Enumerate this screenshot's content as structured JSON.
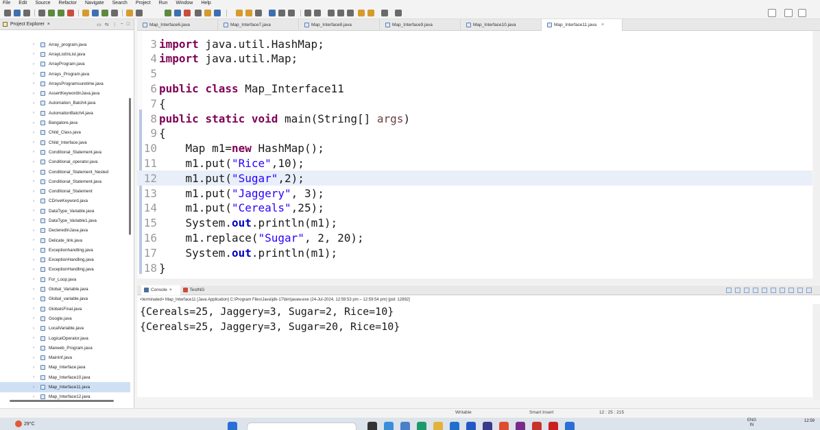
{
  "menu": [
    "File",
    "Edit",
    "Source",
    "Refactor",
    "Navigate",
    "Search",
    "Project",
    "Run",
    "Window",
    "Help"
  ],
  "explorer": {
    "title": "Project Explorer",
    "close": "×",
    "files": [
      "Array_program.java",
      "ArrayListInList.java",
      "ArrayProgram.java",
      "Arrays_Program.java",
      "ArraysProgramsuretime.java",
      "AssertKeywordInJava.java",
      "Automation_Batch4.java",
      "AutomationBatch4.java",
      "Bangalore.java",
      "Child_Class.java",
      "Child_Interface.java",
      "Conditional_Statement.java",
      "Conditional_operator.java",
      "Conditional_Statement_Nested",
      "Conditional_Statement.java",
      "Conditional_Statement",
      "CDriveKeyword.java",
      "DataType_Variable.java",
      "DataType_Variable1.java",
      "DecleredInJava.java",
      "Delicate_link.java",
      "Exceptionhandling.java",
      "ExceptionHandling.java",
      "ExceptionHandling.java",
      "For_Loop.java",
      "Global_Variable.java",
      "Global_variable.java",
      "GlobalsFinal.java",
      "Google.java",
      "LocalVariable.java",
      "LogicalOperator.java",
      "Maneeb_Program.java",
      "MainInf.java",
      "Map_Interface.java",
      "Map_Interface10.java",
      "Map_Interface11.java",
      "Map_Interface12.java"
    ],
    "selected_index": 35
  },
  "tabs": [
    {
      "label": "Map_Interface6.java",
      "active": false
    },
    {
      "label": "Map_Interface7.java",
      "active": false
    },
    {
      "label": "Map_Interface8.java",
      "active": false
    },
    {
      "label": "Map_Interface9.java",
      "active": false
    },
    {
      "label": "Map_Interface10.java",
      "active": false
    },
    {
      "label": "Map_Interface11.java",
      "active": true
    }
  ],
  "tab_close": "×",
  "editor": {
    "highlight_line": 12,
    "lines": [
      {
        "n": "3",
        "indent": "",
        "tokens": [
          {
            "t": "import",
            "c": "kw"
          },
          {
            "t": " java.util.HashMap;",
            "c": ""
          }
        ]
      },
      {
        "n": "4",
        "indent": "",
        "tokens": [
          {
            "t": "import",
            "c": "kw"
          },
          {
            "t": " java.util.Map;",
            "c": ""
          }
        ]
      },
      {
        "n": "5",
        "indent": "",
        "tokens": []
      },
      {
        "n": "6",
        "indent": "",
        "tokens": [
          {
            "t": "public",
            "c": "kw"
          },
          {
            "t": " ",
            "c": ""
          },
          {
            "t": "class",
            "c": "kw"
          },
          {
            "t": " Map_Interface11",
            "c": ""
          }
        ]
      },
      {
        "n": "7",
        "indent": "",
        "tokens": [
          {
            "t": "{",
            "c": ""
          }
        ]
      },
      {
        "n": "8",
        "indent": "",
        "tokens": [
          {
            "t": "public",
            "c": "kw"
          },
          {
            "t": " ",
            "c": ""
          },
          {
            "t": "static",
            "c": "kw"
          },
          {
            "t": " ",
            "c": ""
          },
          {
            "t": "void",
            "c": "kw"
          },
          {
            "t": " main(String[] ",
            "c": ""
          },
          {
            "t": "args",
            "c": "var"
          },
          {
            "t": ")",
            "c": ""
          }
        ]
      },
      {
        "n": "9",
        "indent": "",
        "tokens": [
          {
            "t": "{",
            "c": ""
          }
        ]
      },
      {
        "n": "10",
        "indent": "    ",
        "tokens": [
          {
            "t": "Map m1=",
            "c": ""
          },
          {
            "t": "new",
            "c": "kw"
          },
          {
            "t": " HashMap();",
            "c": ""
          }
        ]
      },
      {
        "n": "11",
        "indent": "    ",
        "tokens": [
          {
            "t": "m1.put(",
            "c": ""
          },
          {
            "t": "\"Rice\"",
            "c": "str"
          },
          {
            "t": ",10);",
            "c": ""
          }
        ]
      },
      {
        "n": "12",
        "indent": "    ",
        "tokens": [
          {
            "t": "m1.put(",
            "c": ""
          },
          {
            "t": "\"Sugar\"",
            "c": "str"
          },
          {
            "t": ",2);",
            "c": ""
          }
        ]
      },
      {
        "n": "13",
        "indent": "    ",
        "tokens": [
          {
            "t": "m1.put(",
            "c": ""
          },
          {
            "t": "\"Jaggery\"",
            "c": "str"
          },
          {
            "t": ", 3);",
            "c": ""
          }
        ]
      },
      {
        "n": "14",
        "indent": "    ",
        "tokens": [
          {
            "t": "m1.put(",
            "c": ""
          },
          {
            "t": "\"Cereals\"",
            "c": "str"
          },
          {
            "t": ",25);",
            "c": ""
          }
        ]
      },
      {
        "n": "15",
        "indent": "    ",
        "tokens": [
          {
            "t": "System.",
            "c": ""
          },
          {
            "t": "out",
            "c": "fld"
          },
          {
            "t": ".println(m1);",
            "c": ""
          }
        ]
      },
      {
        "n": "16",
        "indent": "    ",
        "tokens": [
          {
            "t": "m1.replace(",
            "c": ""
          },
          {
            "t": "\"Sugar\"",
            "c": "str"
          },
          {
            "t": ", 2, 20);",
            "c": ""
          }
        ]
      },
      {
        "n": "17",
        "indent": "    ",
        "tokens": [
          {
            "t": "System.",
            "c": ""
          },
          {
            "t": "out",
            "c": "fld"
          },
          {
            "t": ".println(m1);",
            "c": ""
          }
        ]
      },
      {
        "n": "18",
        "indent": "",
        "tokens": [
          {
            "t": "}",
            "c": ""
          }
        ]
      }
    ]
  },
  "console": {
    "tabs": [
      "Console",
      "TestNG"
    ],
    "status": "<terminated> Map_Interface11 [Java Application] C:\\Program Files\\Java\\jdk-17\\bin\\javaw.exe (24-Jul-2024, 12:59:53 pm – 12:59:54 pm) [pid: 12892]",
    "output": [
      "{Cereals=25, Jaggery=3, Sugar=2, Rice=10}",
      "{Cereals=25, Jaggery=3, Sugar=20, Rice=10}"
    ]
  },
  "status_bar": {
    "writable": "Writable",
    "insert_mode": "Smart Insert",
    "position": "12 : 25 : 215"
  },
  "taskbar": {
    "weather": "29°C",
    "tray_lang": "ENG",
    "tray_region": "IN",
    "time": "12:59"
  }
}
